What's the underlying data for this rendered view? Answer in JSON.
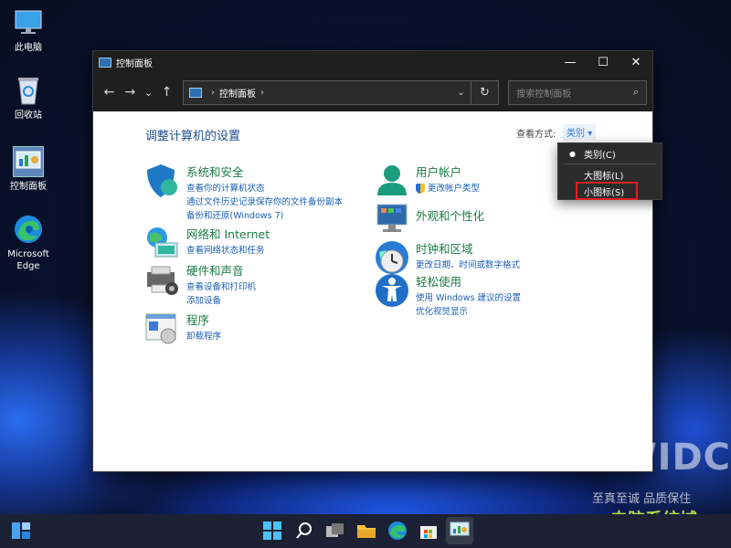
{
  "desktop": {
    "icons": [
      {
        "label": "此电脑",
        "icon": "computer-icon"
      },
      {
        "label": "回收站",
        "icon": "recycle-bin-icon"
      },
      {
        "label": "控制面板",
        "icon": "control-panel-icon"
      },
      {
        "label": "Microsoft Edge",
        "label1": "Microsoft",
        "label2": "Edge",
        "icon": "edge-icon"
      }
    ]
  },
  "window": {
    "title": "控制面板",
    "controls": {
      "minimize": "—",
      "maximize": "☐",
      "close": "✕"
    },
    "nav": {
      "back": "←",
      "forward": "→",
      "recent": "⌄",
      "up": "↑"
    },
    "address": {
      "path": "控制面板",
      "separator": "›",
      "dropdown": "⌄",
      "refresh": "↻"
    },
    "search": {
      "placeholder": "搜索控制面板",
      "icon": "⌕"
    },
    "heading": "调整计算机的设置",
    "view_by_label": "查看方式:",
    "view_by_value": "类别 ▾",
    "categories": [
      {
        "title": "系统和安全",
        "links": [
          "查看你的计算机状态",
          "通过文件历史记录保存你的文件备份副本",
          "备份和还原(Windows 7)"
        ]
      },
      {
        "title": "网络和 Internet",
        "links": [
          "查看网络状态和任务"
        ]
      },
      {
        "title": "硬件和声音",
        "links": [
          "查看设备和打印机",
          "添加设备"
        ]
      },
      {
        "title": "程序",
        "links": [
          "卸载程序"
        ]
      },
      {
        "title": "用户帐户",
        "links": [
          "更改帐户类型"
        ]
      },
      {
        "title": "外观和个性化",
        "links": []
      },
      {
        "title": "时钟和区域",
        "links": [
          "更改日期、时间或数字格式"
        ]
      },
      {
        "title": "轻松使用",
        "links": [
          "使用 Windows 建议的设置",
          "优化视觉显示"
        ]
      }
    ]
  },
  "view_menu": {
    "items": [
      {
        "label": "类别(C)",
        "selected": true
      },
      {
        "label": "大图标(L)",
        "selected": false
      },
      {
        "label": "小图标(S)",
        "selected": false,
        "highlighted": true
      }
    ],
    "bullet": "●"
  },
  "watermark": {
    "line1": "HWIDC",
    "line2": "至真至诚 品质保住",
    "line3": "电脑系统城"
  },
  "colors": {
    "accent": "#1a5fb4",
    "category_title": "#1b7a45",
    "highlight_box": "#e02020"
  }
}
